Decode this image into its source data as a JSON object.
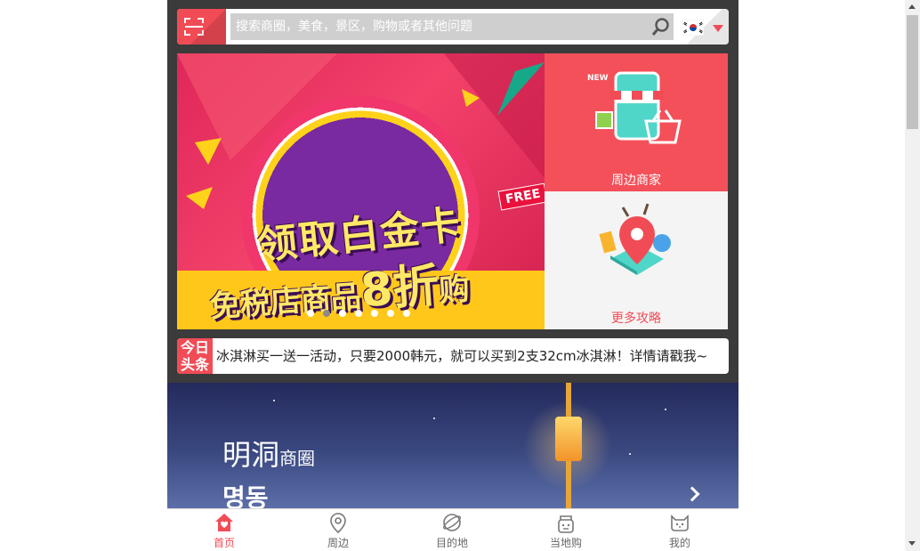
{
  "search": {
    "placeholder": "搜索商圈，美食，景区，购物或者其他问题",
    "scan_icon": "scan-icon",
    "search_icon": "magnifier-icon",
    "language_flag": "south-korea-flag-icon"
  },
  "banner": {
    "line1": "领取白金卡",
    "line2_prefix": "免税店商品",
    "line2_big": "8折",
    "line2_suffix": "购",
    "tag": "FREE",
    "slide_count": 7,
    "active_slide": 2
  },
  "tiles": {
    "nearby": {
      "label": "周边商家",
      "icon": "shop-phone-icon"
    },
    "guides": {
      "label": "更多攻略",
      "icon": "map-pin-travel-icon"
    }
  },
  "headline": {
    "badge_line1": "今日",
    "badge_line2": "头条",
    "text": "冰淇淋买一送一活动，只要2000韩元，就可以买到2支32cm冰淇淋！详情请戳我~"
  },
  "district": {
    "title": "明洞",
    "title_suffix": "商圈",
    "korean": "명동"
  },
  "tabs": [
    {
      "label": "首页",
      "icon": "home-heart-icon",
      "active": true
    },
    {
      "label": "周边",
      "icon": "location-pin-icon",
      "active": false
    },
    {
      "label": "目的地",
      "icon": "planet-icon",
      "active": false
    },
    {
      "label": "当地购",
      "icon": "shopping-mascot-icon",
      "active": false
    },
    {
      "label": "我的",
      "icon": "cat-face-icon",
      "active": false
    }
  ],
  "colors": {
    "accent": "#f14c56",
    "frame": "#3b3b3b",
    "banner_yellow": "#ffc719"
  }
}
